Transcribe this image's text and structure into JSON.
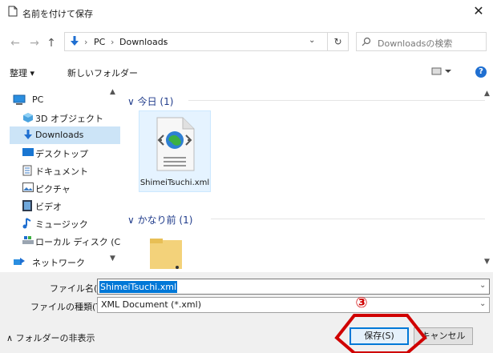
{
  "window": {
    "title": "名前を付けて保存",
    "close_glyph": "✕"
  },
  "address": {
    "sep": "›",
    "pc": "PC",
    "downloads": "Downloads",
    "search_placeholder": "Downloadsの検索",
    "refresh_glyph": "↻",
    "dropdown_glyph": "⌄"
  },
  "toolbar": {
    "organize": "整理 ▾",
    "new_folder": "新しいフォルダー",
    "help": "?"
  },
  "sidebar": {
    "items": [
      {
        "label": "PC",
        "icon": "pc-icon"
      },
      {
        "label": "3D オブジェクト",
        "icon": "3d-objects-icon"
      },
      {
        "label": "Downloads",
        "icon": "downloads-icon"
      },
      {
        "label": "デスクトップ",
        "icon": "desktop-icon"
      },
      {
        "label": "ドキュメント",
        "icon": "documents-icon"
      },
      {
        "label": "ピクチャ",
        "icon": "pictures-icon"
      },
      {
        "label": "ビデオ",
        "icon": "videos-icon"
      },
      {
        "label": "ミュージック",
        "icon": "music-icon"
      },
      {
        "label": "ローカル ディスク (C",
        "icon": "local-disk-icon"
      },
      {
        "label": "ネットワーク",
        "icon": "network-icon"
      }
    ],
    "selected_index": 2
  },
  "files": {
    "groups": [
      {
        "header": "今日 (1)"
      },
      {
        "header": "かなり前 (1)"
      }
    ],
    "item_name": "ShimeiTsuchi.xml"
  },
  "bottom": {
    "filename_label": "ファイル名(N):",
    "filename_value": "ShimeiTsuchi.xml",
    "filetype_label": "ファイルの種類(T):",
    "filetype_value": "XML Document (*.xml)",
    "hide_folders": "フォルダーの非表示",
    "save": "保存(S)",
    "cancel": "キャンセル"
  },
  "annotation": {
    "number": "③",
    "color": "#d00000"
  },
  "colors": {
    "accent": "#0078d7",
    "selection": "#cce4f7"
  }
}
